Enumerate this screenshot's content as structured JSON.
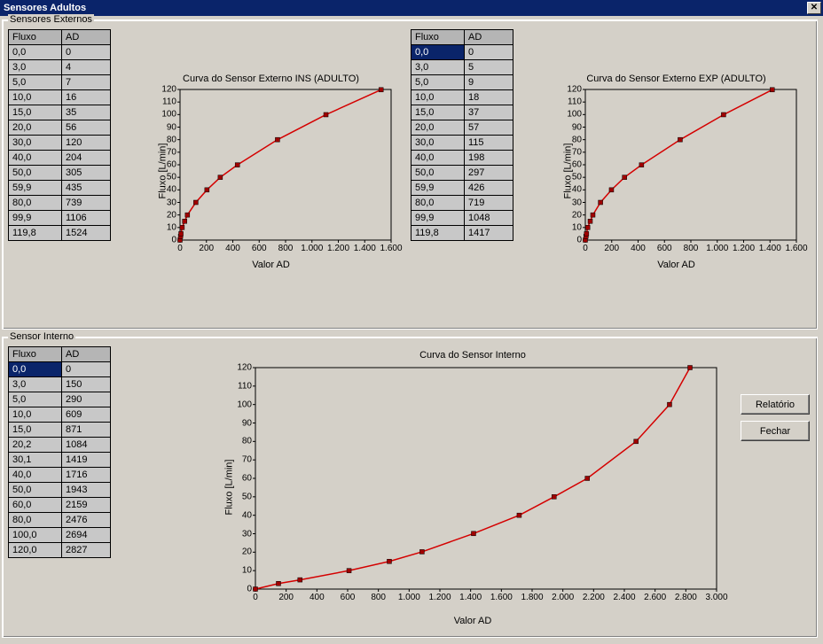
{
  "window_title": "Sensores Adultos",
  "group_externos_label": "Sensores Externos",
  "group_interno_label": "Sensor Interno",
  "col_fluxo": "Fluxo",
  "col_ad": "AD",
  "buttons": {
    "relatorio": "Relatório",
    "fechar": "Fechar"
  },
  "ylabel": "Fluxo [L/min]",
  "xlabel": "Valor AD",
  "table_ins": {
    "rows": [
      {
        "fluxo": "0,0",
        "ad": "0"
      },
      {
        "fluxo": "3,0",
        "ad": "4"
      },
      {
        "fluxo": "5,0",
        "ad": "7"
      },
      {
        "fluxo": "10,0",
        "ad": "16"
      },
      {
        "fluxo": "15,0",
        "ad": "35"
      },
      {
        "fluxo": "20,0",
        "ad": "56"
      },
      {
        "fluxo": "30,0",
        "ad": "120"
      },
      {
        "fluxo": "40,0",
        "ad": "204"
      },
      {
        "fluxo": "50,0",
        "ad": "305"
      },
      {
        "fluxo": "59,9",
        "ad": "435"
      },
      {
        "fluxo": "80,0",
        "ad": "739"
      },
      {
        "fluxo": "99,9",
        "ad": "1106"
      },
      {
        "fluxo": "119,8",
        "ad": "1524"
      }
    ]
  },
  "table_exp": {
    "rows": [
      {
        "fluxo": "0,0",
        "ad": "0"
      },
      {
        "fluxo": "3,0",
        "ad": "5"
      },
      {
        "fluxo": "5,0",
        "ad": "9"
      },
      {
        "fluxo": "10,0",
        "ad": "18"
      },
      {
        "fluxo": "15,0",
        "ad": "37"
      },
      {
        "fluxo": "20,0",
        "ad": "57"
      },
      {
        "fluxo": "30,0",
        "ad": "115"
      },
      {
        "fluxo": "40,0",
        "ad": "198"
      },
      {
        "fluxo": "50,0",
        "ad": "297"
      },
      {
        "fluxo": "59,9",
        "ad": "426"
      },
      {
        "fluxo": "80,0",
        "ad": "719"
      },
      {
        "fluxo": "99,9",
        "ad": "1048"
      },
      {
        "fluxo": "119,8",
        "ad": "1417"
      }
    ]
  },
  "table_int": {
    "rows": [
      {
        "fluxo": "0,0",
        "ad": "0"
      },
      {
        "fluxo": "3,0",
        "ad": "150"
      },
      {
        "fluxo": "5,0",
        "ad": "290"
      },
      {
        "fluxo": "10,0",
        "ad": "609"
      },
      {
        "fluxo": "15,0",
        "ad": "871"
      },
      {
        "fluxo": "20,2",
        "ad": "1084"
      },
      {
        "fluxo": "30,1",
        "ad": "1419"
      },
      {
        "fluxo": "40,0",
        "ad": "1716"
      },
      {
        "fluxo": "50,0",
        "ad": "1943"
      },
      {
        "fluxo": "60,0",
        "ad": "2159"
      },
      {
        "fluxo": "80,0",
        "ad": "2476"
      },
      {
        "fluxo": "100,0",
        "ad": "2694"
      },
      {
        "fluxo": "120,0",
        "ad": "2827"
      }
    ]
  },
  "chart_data": [
    {
      "id": "ins",
      "type": "line",
      "title": "Curva do Sensor Externo INS (ADULTO)",
      "xlabel": "Valor AD",
      "ylabel": "Fluxo [L/min]",
      "xlim": [
        0,
        1600
      ],
      "ylim": [
        0,
        120
      ],
      "xticks": [
        0,
        200,
        400,
        600,
        800,
        1000,
        1200,
        1400,
        1600
      ],
      "xtick_labels": [
        "0",
        "200",
        "400",
        "600",
        "800",
        "1.000",
        "1.200",
        "1.400",
        "1.600"
      ],
      "yticks": [
        0,
        10,
        20,
        30,
        40,
        50,
        60,
        70,
        80,
        90,
        100,
        110,
        120
      ],
      "x": [
        0,
        4,
        7,
        16,
        35,
        56,
        120,
        204,
        305,
        435,
        739,
        1106,
        1524
      ],
      "y": [
        0,
        3,
        5,
        10,
        15,
        20,
        30,
        40,
        50,
        59.9,
        80,
        99.9,
        119.8
      ]
    },
    {
      "id": "exp",
      "type": "line",
      "title": "Curva do Sensor Externo EXP (ADULTO)",
      "xlabel": "Valor AD",
      "ylabel": "Fluxo [L/min]",
      "xlim": [
        0,
        1600
      ],
      "ylim": [
        0,
        120
      ],
      "xticks": [
        0,
        200,
        400,
        600,
        800,
        1000,
        1200,
        1400,
        1600
      ],
      "xtick_labels": [
        "0",
        "200",
        "400",
        "600",
        "800",
        "1.000",
        "1.200",
        "1.400",
        "1.600"
      ],
      "yticks": [
        0,
        10,
        20,
        30,
        40,
        50,
        60,
        70,
        80,
        90,
        100,
        110,
        120
      ],
      "x": [
        0,
        5,
        9,
        18,
        37,
        57,
        115,
        198,
        297,
        426,
        719,
        1048,
        1417
      ],
      "y": [
        0,
        3,
        5,
        10,
        15,
        20,
        30,
        40,
        50,
        59.9,
        80,
        99.9,
        119.8
      ]
    },
    {
      "id": "int",
      "type": "line",
      "title": "Curva do Sensor Interno",
      "xlabel": "Valor AD",
      "ylabel": "Fluxo [L/min]",
      "xlim": [
        0,
        3000
      ],
      "ylim": [
        0,
        120
      ],
      "xticks": [
        0,
        200,
        400,
        600,
        800,
        1000,
        1200,
        1400,
        1600,
        1800,
        2000,
        2200,
        2400,
        2600,
        2800,
        3000
      ],
      "xtick_labels": [
        "0",
        "200",
        "400",
        "600",
        "800",
        "1.000",
        "1.200",
        "1.400",
        "1.600",
        "1.800",
        "2.000",
        "2.200",
        "2.400",
        "2.600",
        "2.800",
        "3.000"
      ],
      "yticks": [
        0,
        10,
        20,
        30,
        40,
        50,
        60,
        70,
        80,
        90,
        100,
        110,
        120
      ],
      "x": [
        0,
        150,
        290,
        609,
        871,
        1084,
        1419,
        1716,
        1943,
        2159,
        2476,
        2694,
        2827
      ],
      "y": [
        0,
        3,
        5,
        10,
        15,
        20.2,
        30.1,
        40,
        50,
        60,
        80,
        100,
        120
      ]
    }
  ]
}
